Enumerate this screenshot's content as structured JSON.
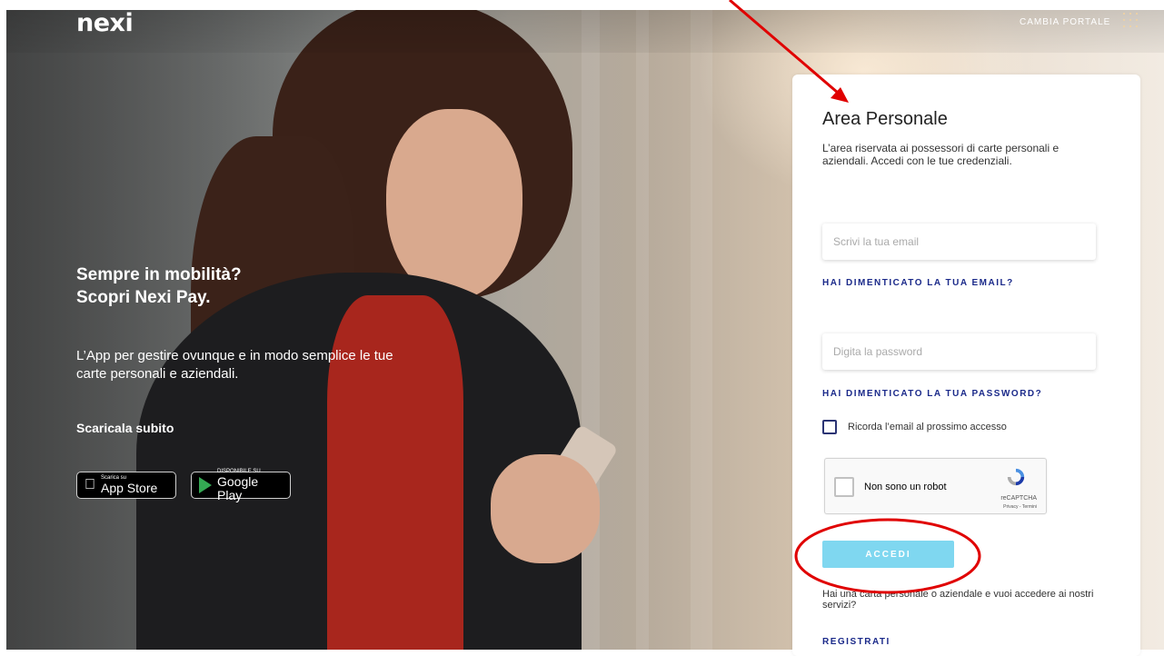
{
  "brand": {
    "logo_text": "nexi"
  },
  "header": {
    "change_portal": "CAMBIA PORTALE"
  },
  "promo": {
    "title_line1": "Sempre in mobilità?",
    "title_line2": "Scopri Nexi Pay.",
    "description": "L’App per gestire ovunque e in modo semplice le tue carte personali e aziendali.",
    "cta": "Scaricala subito",
    "app_store": {
      "small": "Scarica su",
      "big": "App Store"
    },
    "google_play": {
      "small": "DISPONIBILE SU",
      "big": "Google Play"
    }
  },
  "login": {
    "title": "Area Personale",
    "description": "L’area riservata ai possessori di carte personali e aziendali. Accedi con le tue credenziali.",
    "email_placeholder": "Scrivi la tua email",
    "forgot_email": "HAI DIMENTICATO LA TUA EMAIL?",
    "password_placeholder": "Digita la password",
    "forgot_password": "HAI DIMENTICATO LA TUA PASSWORD?",
    "remember_label": "Ricorda l’email al prossimo accesso",
    "recaptcha": {
      "label": "Non sono un robot",
      "name": "reCAPTCHA",
      "links": "Privacy - Termini"
    },
    "submit_label": "ACCEDI",
    "register_text": "Hai una carta personale o aziendale e vuoi accedere ai nostri servizi?",
    "register_link": "REGISTRATI"
  },
  "colors": {
    "accent_blue": "#1b2a8a",
    "button_cyan": "#7fd7f0",
    "annotation_red": "#e00000"
  }
}
